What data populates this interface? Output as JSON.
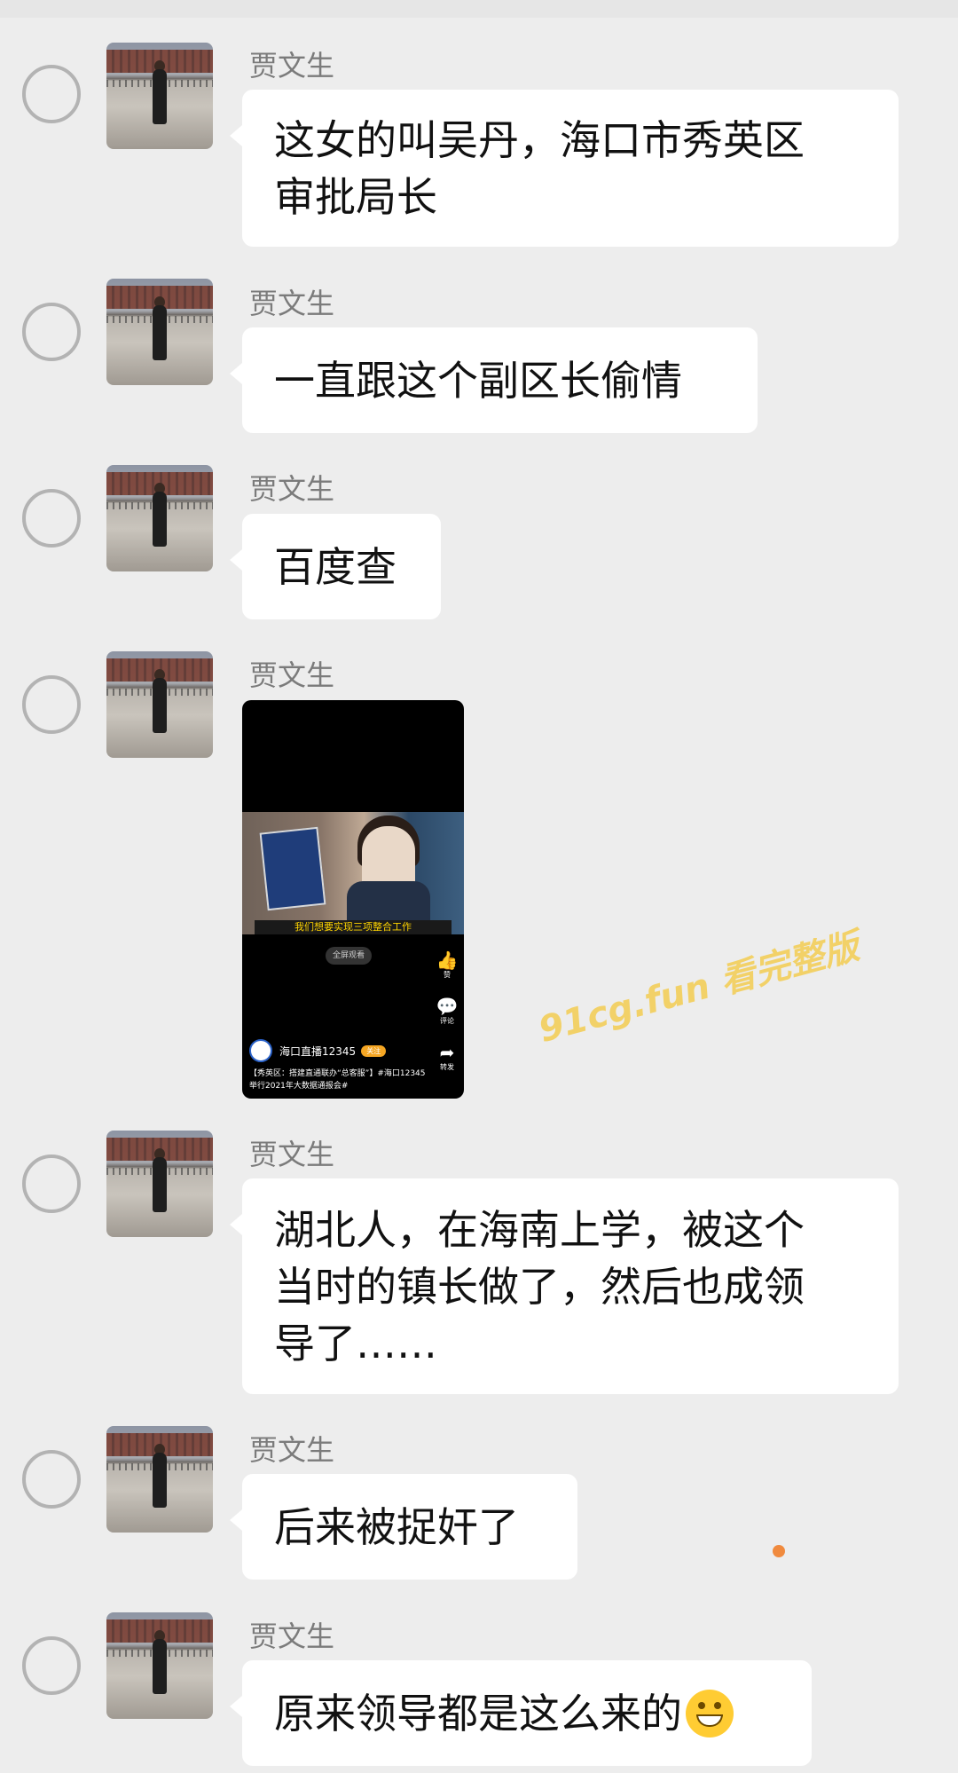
{
  "chat": {
    "messages": [
      {
        "sender": "贾文生",
        "text": "这女的叫吴丹，海口市秀英区审批局长",
        "lines": [
          "这女的叫吴丹，海口市秀英区",
          "审批局长"
        ]
      },
      {
        "sender": "贾文生",
        "text": "一直跟这个副区长偷情"
      },
      {
        "sender": "贾文生",
        "text": "百度查"
      },
      {
        "sender": "贾文生",
        "video": {
          "caption": "我们想要实现三项整合工作",
          "fullscreen_label": "全屏观看",
          "side_actions": [
            "赞",
            "评论",
            "转发"
          ],
          "channel_name": "海口直播12345",
          "follow_label": "关注",
          "description": "【秀英区：搭建直通联办“总客服”】#海口12345举行2021年大数据通报会#"
        }
      },
      {
        "sender": "贾文生",
        "text": "湖北人，在海南上学，被这个当时的镇长做了，然后也成领导了……",
        "lines": [
          "湖北人，在海南上学，被这个",
          "当时的镇长做了，然后也成领",
          "导了……"
        ]
      },
      {
        "sender": "贾文生",
        "text": "后来被捉奸了"
      },
      {
        "sender": "贾文生",
        "text": "原来领导都是这么来的",
        "emoji": "grinning-face-emoji"
      }
    ]
  },
  "watermark": "91cg.fun 看完整版",
  "colors": {
    "background": "#ededed",
    "bubble": "#ffffff",
    "name": "#7b7b7b",
    "watermark": "#f3cf5a",
    "dot": "#f08a3e"
  }
}
